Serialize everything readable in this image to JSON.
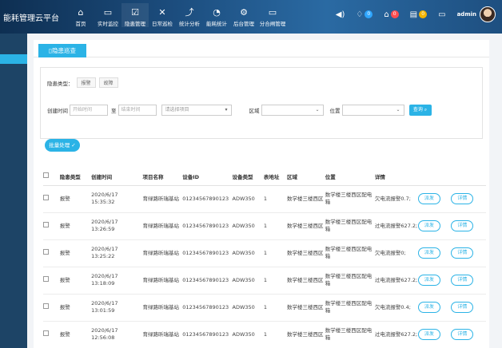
{
  "app": {
    "title": "能耗管理云平台"
  },
  "nav": [
    {
      "label": "首页",
      "icon": "home-icon",
      "glyph": "⌂"
    },
    {
      "label": "实时监控",
      "icon": "monitor-icon",
      "glyph": "▭"
    },
    {
      "label": "隐患管理",
      "icon": "clipboard-icon",
      "glyph": "☑"
    },
    {
      "label": "日常巡检",
      "icon": "tools-icon",
      "glyph": "✕"
    },
    {
      "label": "统计分析",
      "icon": "chart-icon",
      "glyph": "⤴"
    },
    {
      "label": "能耗统计",
      "icon": "bulb-icon",
      "glyph": "◔"
    },
    {
      "label": "后台管理",
      "icon": "settings-icon",
      "glyph": "⚙"
    },
    {
      "label": "分合闸管理",
      "icon": "switch-icon",
      "glyph": "▭"
    }
  ],
  "toolbar": {
    "sound_glyph": "◀)",
    "alarm_count": "0",
    "warning_count": "0",
    "message_count": "0",
    "user": "admin"
  },
  "page": {
    "tab_label": "隐患巡查"
  },
  "filter": {
    "type_label": "隐患类型：",
    "type_options": [
      "报警",
      "故障"
    ],
    "created_label": "创建时间",
    "start_placeholder": "开始时间",
    "to_label": "至",
    "end_placeholder": "结束时间",
    "project_placeholder": "请选择项目",
    "area_label": "区域",
    "location_label": "位置",
    "query_label": "查询"
  },
  "batch_label": "批量处理 ✓",
  "table": {
    "headers": [
      "隐患类型",
      "创建时间",
      "项目名称",
      "设备ID",
      "设备类型",
      "表地址",
      "区域",
      "位置",
      "详情"
    ],
    "dispatch_label": "派发",
    "detail_label": "详情",
    "rows": [
      {
        "type": "报警",
        "date": "2020/6/17",
        "time": "15:35:32",
        "project": "育绿路昕瑞基站",
        "id": "01234567890123",
        "dtype": "ADW350",
        "addr": "1",
        "area": "数学楼三楼西区",
        "loc": "数学楼三楼西区配电箱",
        "detail": "欠电流报警0.7;"
      },
      {
        "type": "报警",
        "date": "2020/6/17",
        "time": "13:26:59",
        "project": "育绿路昕瑞基站",
        "id": "01234567890123",
        "dtype": "ADW350",
        "addr": "1",
        "area": "数学楼三楼西区",
        "loc": "数学楼三楼西区配电箱",
        "detail": "过电流报警627.2;"
      },
      {
        "type": "报警",
        "date": "2020/6/17",
        "time": "13:25:22",
        "project": "育绿路昕瑞基站",
        "id": "01234567890123",
        "dtype": "ADW350",
        "addr": "1",
        "area": "数学楼三楼西区",
        "loc": "数学楼三楼西区配电箱",
        "detail": "欠电流报警0;"
      },
      {
        "type": "报警",
        "date": "2020/6/17",
        "time": "13:18:09",
        "project": "育绿路昕瑞基站",
        "id": "01234567890123",
        "dtype": "ADW350",
        "addr": "1",
        "area": "数学楼三楼西区",
        "loc": "数学楼三楼西区配电箱",
        "detail": "过电流报警627.2;"
      },
      {
        "type": "报警",
        "date": "2020/6/17",
        "time": "13:01:59",
        "project": "育绿路昕瑞基站",
        "id": "01234567890123",
        "dtype": "ADW350",
        "addr": "1",
        "area": "数学楼三楼西区",
        "loc": "数学楼三楼西区配电箱",
        "detail": "欠电流报警0.4;"
      },
      {
        "type": "报警",
        "date": "2020/6/17",
        "time": "12:56:08",
        "project": "育绿路昕瑞基站",
        "id": "01234567890123",
        "dtype": "ADW350",
        "addr": "1",
        "area": "数学楼三楼西区",
        "loc": "数学楼三楼西区配电箱",
        "detail": "过电流报警627.2;"
      }
    ]
  }
}
